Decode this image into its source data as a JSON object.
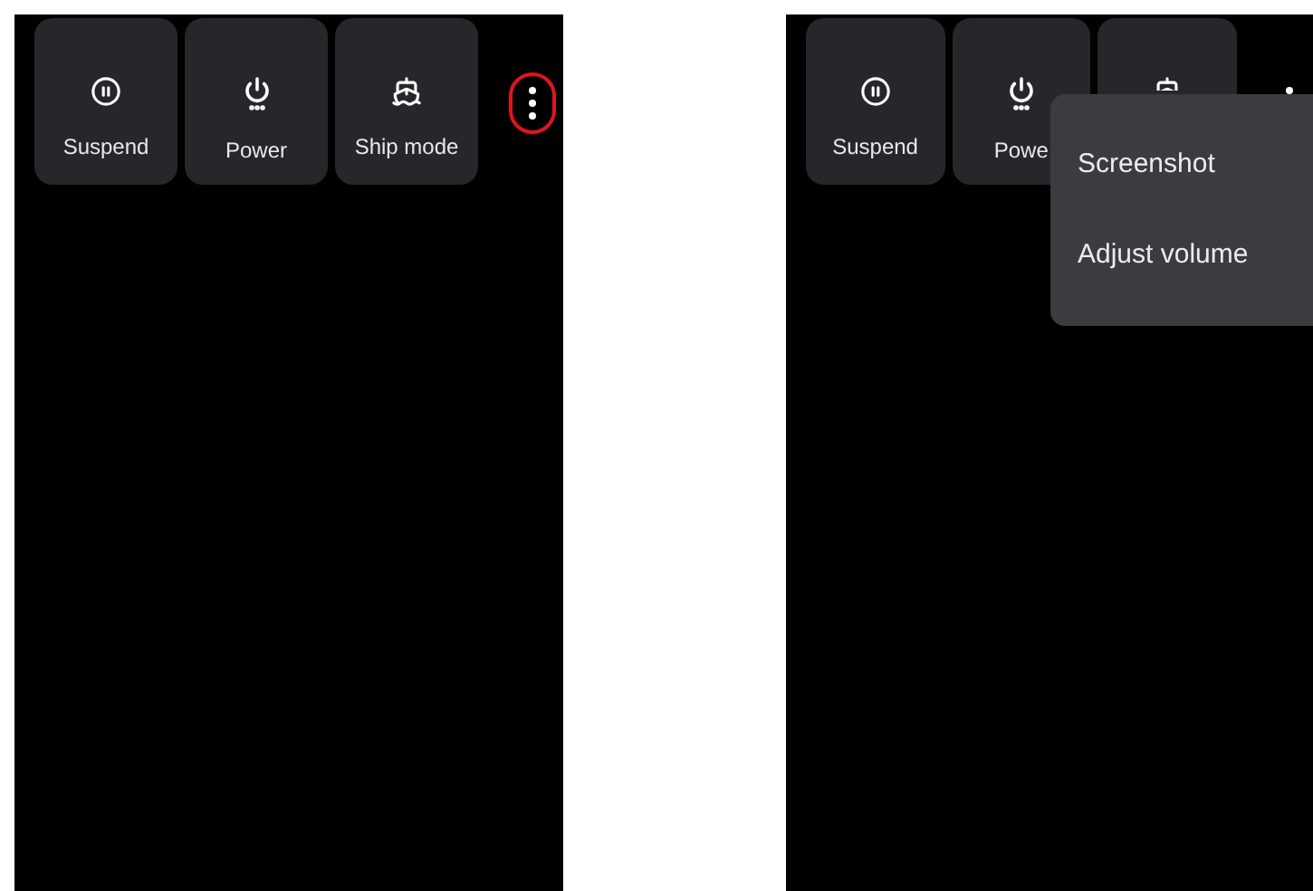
{
  "screens": [
    {
      "tiles": [
        {
          "kind": "suspend",
          "label": "Suspend"
        },
        {
          "kind": "power",
          "label": "Power"
        },
        {
          "kind": "ship",
          "label": "Ship mode"
        }
      ],
      "more_button": {
        "highlighted": true
      }
    },
    {
      "tiles": [
        {
          "kind": "suspend",
          "label": "Suspend"
        },
        {
          "kind": "power",
          "label": "Powe"
        },
        {
          "kind": "ship"
        }
      ],
      "menu": {
        "items": [
          "Screenshot",
          "Adjust volume"
        ]
      }
    }
  ]
}
